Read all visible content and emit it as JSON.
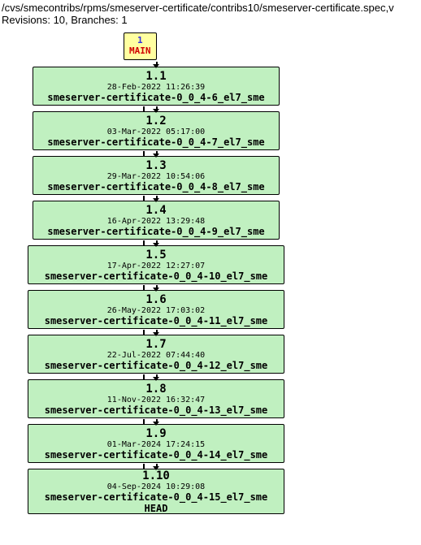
{
  "header": {
    "path": "/cvs/smecontribs/rpms/smeserver-certificate/contribs10/smeserver-certificate.spec,v",
    "info": "Revisions: 10, Branches: 1"
  },
  "main": {
    "num": "1",
    "label": "MAIN"
  },
  "revisions": [
    {
      "version": "1.1",
      "date": "28-Feb-2022 11:26:39",
      "tag": "smeserver-certificate-0_0_4-6_el7_sme",
      "head": ""
    },
    {
      "version": "1.2",
      "date": "03-Mar-2022 05:17:00",
      "tag": "smeserver-certificate-0_0_4-7_el7_sme",
      "head": ""
    },
    {
      "version": "1.3",
      "date": "29-Mar-2022 10:54:06",
      "tag": "smeserver-certificate-0_0_4-8_el7_sme",
      "head": ""
    },
    {
      "version": "1.4",
      "date": "16-Apr-2022 13:29:48",
      "tag": "smeserver-certificate-0_0_4-9_el7_sme",
      "head": ""
    },
    {
      "version": "1.5",
      "date": "17-Apr-2022 12:27:07",
      "tag": "smeserver-certificate-0_0_4-10_el7_sme",
      "head": ""
    },
    {
      "version": "1.6",
      "date": "26-May-2022 17:03:02",
      "tag": "smeserver-certificate-0_0_4-11_el7_sme",
      "head": ""
    },
    {
      "version": "1.7",
      "date": "22-Jul-2022 07:44:40",
      "tag": "smeserver-certificate-0_0_4-12_el7_sme",
      "head": ""
    },
    {
      "version": "1.8",
      "date": "11-Nov-2022 16:32:47",
      "tag": "smeserver-certificate-0_0_4-13_el7_sme",
      "head": ""
    },
    {
      "version": "1.9",
      "date": "01-Mar-2024 17:24:15",
      "tag": "smeserver-certificate-0_0_4-14_el7_sme",
      "head": ""
    },
    {
      "version": "1.10",
      "date": "04-Sep-2024 10:29:08",
      "tag": "smeserver-certificate-0_0_4-15_el7_sme",
      "head": "HEAD"
    }
  ]
}
